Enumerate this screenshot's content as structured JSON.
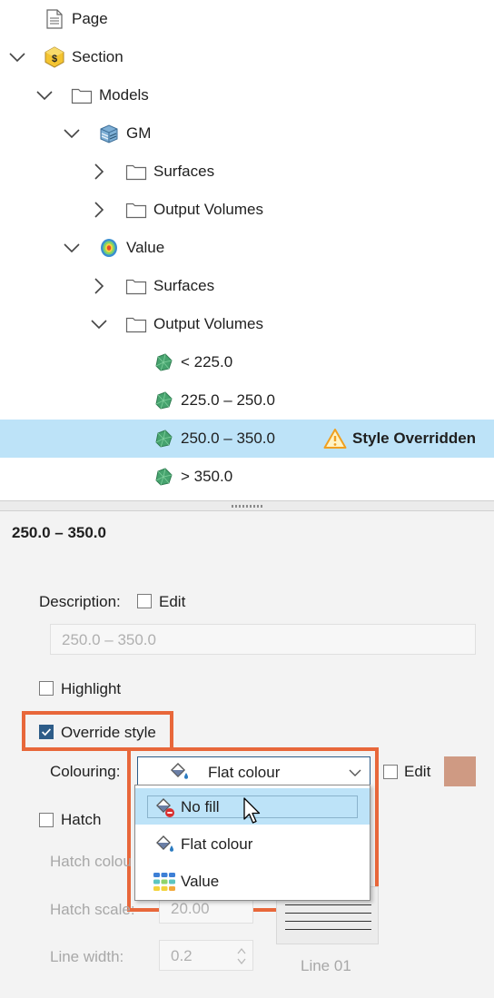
{
  "tree": {
    "items": [
      {
        "label": "Page",
        "icon": "page-icon",
        "expanded": null
      },
      {
        "label": "Section",
        "icon": "section-icon",
        "expanded": true
      },
      {
        "label": "Models",
        "icon": "folder-icon",
        "expanded": true
      },
      {
        "label": "GM",
        "icon": "geological-model-icon",
        "expanded": true
      },
      {
        "label": "Surfaces",
        "icon": "folder-icon",
        "expanded": false
      },
      {
        "label": "Output Volumes",
        "icon": "folder-icon",
        "expanded": false
      },
      {
        "label": "Value",
        "icon": "numeric-model-icon",
        "expanded": true
      },
      {
        "label": "Surfaces",
        "icon": "folder-icon",
        "expanded": false
      },
      {
        "label": "Output Volumes",
        "icon": "folder-icon",
        "expanded": true
      },
      {
        "label": "< 225.0",
        "icon": "volume-icon",
        "expanded": null
      },
      {
        "label": "225.0 – 250.0",
        "icon": "volume-icon",
        "expanded": null
      },
      {
        "label": "250.0 – 350.0",
        "icon": "volume-icon",
        "expanded": null,
        "selected": true,
        "status": "Style Overridden",
        "status_icon": "warning-icon"
      },
      {
        "label": "> 350.0",
        "icon": "volume-icon",
        "expanded": null
      }
    ]
  },
  "properties": {
    "title": "250.0 – 350.0",
    "description_label": "Description:",
    "description_edit_label": "Edit",
    "description_value": "250.0 – 350.0",
    "highlight_label": "Highlight",
    "highlight_checked": false,
    "override_label": "Override style",
    "override_checked": true,
    "colouring_label": "Colouring:",
    "colouring_value": "Flat colour",
    "colour_edit_label": "Edit",
    "colour_swatch": "#cf9a83",
    "hatch_label": "Hatch",
    "hatch_colour_label": "Hatch colou",
    "hatch_scale_label": "Hatch scale:",
    "hatch_scale_value": "20.00",
    "line_width_label": "Line width:",
    "line_width_value": "0.2",
    "line_style_label": "Line 01"
  },
  "dropdown": {
    "options": [
      {
        "label": "No fill",
        "icon": "no-fill-icon",
        "hover": true
      },
      {
        "label": "Flat colour",
        "icon": "flat-colour-icon"
      },
      {
        "label": "Value",
        "icon": "value-colour-icon"
      }
    ]
  },
  "colors": {
    "selection": "#bde3f8",
    "highlight_frame": "#e8673a",
    "checkbox_checked": "#2d5c88",
    "warning": "#f0a020"
  }
}
